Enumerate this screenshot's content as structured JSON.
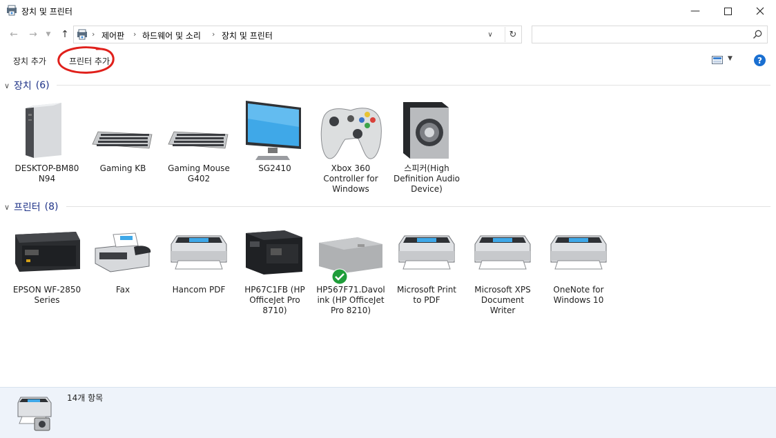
{
  "window": {
    "title": "장치 및 프린터",
    "controls": [
      "minimize-icon",
      "maximize-icon",
      "close-icon"
    ]
  },
  "navigation": {
    "breadcrumb": [
      "제어판",
      "하드웨어 및 소리",
      "장치 및 프린터"
    ],
    "search_placeholder": ""
  },
  "commands": {
    "add_device": "장치 추가",
    "add_printer": "프린터 추가"
  },
  "devices": {
    "header": "장치",
    "count": "(6)",
    "items": [
      {
        "label": "DESKTOP-BM80N94",
        "line1": "DESKTOP-BM80",
        "line2": "N94",
        "line3": "",
        "icon": "computer-icon"
      },
      {
        "label": "Gaming KB",
        "line1": "Gaming KB",
        "line2": "",
        "line3": "",
        "icon": "keyboard-icon"
      },
      {
        "label": "Gaming Mouse G402",
        "line1": "Gaming Mouse",
        "line2": "G402",
        "line3": "",
        "icon": "keyboard-icon"
      },
      {
        "label": "SG2410",
        "line1": "SG2410",
        "line2": "",
        "line3": "",
        "icon": "monitor-icon"
      },
      {
        "label": "Xbox 360 Controller for Windows",
        "line1": "Xbox 360",
        "line2": "Controller for",
        "line3": "Windows",
        "icon": "gamepad-icon"
      },
      {
        "label": "스피커(High Definition Audio Device)",
        "line1": "스피커(High",
        "line2": "Definition Audio",
        "line3": "Device)",
        "icon": "speaker-icon"
      }
    ]
  },
  "printers": {
    "header": "프린터",
    "count": "(8)",
    "items": [
      {
        "label": "EPSON WF-2850 Series",
        "line1": "EPSON WF-2850",
        "line2": "Series",
        "line3": "",
        "icon": "inkjet-printer-icon"
      },
      {
        "label": "Fax",
        "line1": "Fax",
        "line2": "",
        "line3": "",
        "icon": "fax-icon"
      },
      {
        "label": "Hancom PDF",
        "line1": "Hancom PDF",
        "line2": "",
        "line3": "",
        "icon": "printer-icon"
      },
      {
        "label": "HP67C1FB (HP OfficeJet Pro 8710)",
        "line1": "HP67C1FB (HP",
        "line2": "OfficeJet Pro",
        "line3": "8710)",
        "icon": "multifunction-printer-icon"
      },
      {
        "label": "HP567F71.Davolink (HP OfficeJet Pro 8210)",
        "line1": "HP567F71.Davol",
        "line2": "ink (HP OfficeJet",
        "line3": "Pro 8210)",
        "icon": "default-printer-icon",
        "default": true
      },
      {
        "label": "Microsoft Print to PDF",
        "line1": "Microsoft Print",
        "line2": "to PDF",
        "line3": "",
        "icon": "printer-icon"
      },
      {
        "label": "Microsoft XPS Document Writer",
        "line1": "Microsoft XPS",
        "line2": "Document",
        "line3": "Writer",
        "icon": "printer-icon"
      },
      {
        "label": "OneNote for Windows 10",
        "line1": "OneNote for",
        "line2": "Windows 10",
        "line3": "",
        "icon": "printer-icon"
      }
    ]
  },
  "status": {
    "item_count": "14개 항목"
  },
  "colors": {
    "group_header": "#1e3287",
    "status_bg": "#eef3fa",
    "annotation": "#e0201b",
    "help": "#1a6fd1",
    "default_check": "#1f9d3a"
  }
}
